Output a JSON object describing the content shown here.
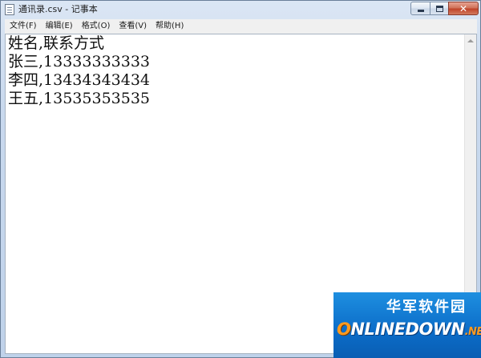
{
  "window": {
    "title": "通讯录.csv - 记事本"
  },
  "menubar": {
    "items": [
      "文件(F)",
      "编辑(E)",
      "格式(O)",
      "查看(V)",
      "帮助(H)"
    ]
  },
  "document": {
    "lines": [
      "姓名,联系方式",
      "张三,13333333333",
      "李四,13434343434",
      "王五,13535353535"
    ]
  },
  "watermark": {
    "top_text": "华军软件园",
    "logo_first": "O",
    "logo_rest": "NLINEDOWN",
    "logo_tld": ".NET"
  },
  "icons": {
    "app": "notepad-icon",
    "minimize": "minimize-icon",
    "maximize": "maximize-icon",
    "close": "close-icon"
  },
  "colors": {
    "close_button": "#c0442a",
    "watermark_blue": "#0b6cc8",
    "watermark_orange": "#ff9a1f"
  }
}
